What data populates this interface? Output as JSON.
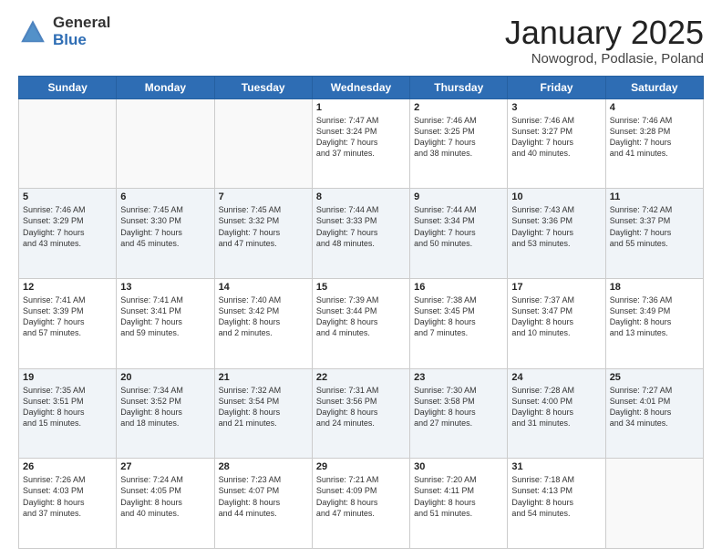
{
  "logo": {
    "general": "General",
    "blue": "Blue"
  },
  "title": {
    "month": "January 2025",
    "location": "Nowogrod, Podlasie, Poland"
  },
  "weekdays": [
    "Sunday",
    "Monday",
    "Tuesday",
    "Wednesday",
    "Thursday",
    "Friday",
    "Saturday"
  ],
  "weeks": [
    [
      {
        "day": "",
        "text": ""
      },
      {
        "day": "",
        "text": ""
      },
      {
        "day": "",
        "text": ""
      },
      {
        "day": "1",
        "text": "Sunrise: 7:47 AM\nSunset: 3:24 PM\nDaylight: 7 hours\nand 37 minutes."
      },
      {
        "day": "2",
        "text": "Sunrise: 7:46 AM\nSunset: 3:25 PM\nDaylight: 7 hours\nand 38 minutes."
      },
      {
        "day": "3",
        "text": "Sunrise: 7:46 AM\nSunset: 3:27 PM\nDaylight: 7 hours\nand 40 minutes."
      },
      {
        "day": "4",
        "text": "Sunrise: 7:46 AM\nSunset: 3:28 PM\nDaylight: 7 hours\nand 41 minutes."
      }
    ],
    [
      {
        "day": "5",
        "text": "Sunrise: 7:46 AM\nSunset: 3:29 PM\nDaylight: 7 hours\nand 43 minutes."
      },
      {
        "day": "6",
        "text": "Sunrise: 7:45 AM\nSunset: 3:30 PM\nDaylight: 7 hours\nand 45 minutes."
      },
      {
        "day": "7",
        "text": "Sunrise: 7:45 AM\nSunset: 3:32 PM\nDaylight: 7 hours\nand 47 minutes."
      },
      {
        "day": "8",
        "text": "Sunrise: 7:44 AM\nSunset: 3:33 PM\nDaylight: 7 hours\nand 48 minutes."
      },
      {
        "day": "9",
        "text": "Sunrise: 7:44 AM\nSunset: 3:34 PM\nDaylight: 7 hours\nand 50 minutes."
      },
      {
        "day": "10",
        "text": "Sunrise: 7:43 AM\nSunset: 3:36 PM\nDaylight: 7 hours\nand 53 minutes."
      },
      {
        "day": "11",
        "text": "Sunrise: 7:42 AM\nSunset: 3:37 PM\nDaylight: 7 hours\nand 55 minutes."
      }
    ],
    [
      {
        "day": "12",
        "text": "Sunrise: 7:41 AM\nSunset: 3:39 PM\nDaylight: 7 hours\nand 57 minutes."
      },
      {
        "day": "13",
        "text": "Sunrise: 7:41 AM\nSunset: 3:41 PM\nDaylight: 7 hours\nand 59 minutes."
      },
      {
        "day": "14",
        "text": "Sunrise: 7:40 AM\nSunset: 3:42 PM\nDaylight: 8 hours\nand 2 minutes."
      },
      {
        "day": "15",
        "text": "Sunrise: 7:39 AM\nSunset: 3:44 PM\nDaylight: 8 hours\nand 4 minutes."
      },
      {
        "day": "16",
        "text": "Sunrise: 7:38 AM\nSunset: 3:45 PM\nDaylight: 8 hours\nand 7 minutes."
      },
      {
        "day": "17",
        "text": "Sunrise: 7:37 AM\nSunset: 3:47 PM\nDaylight: 8 hours\nand 10 minutes."
      },
      {
        "day": "18",
        "text": "Sunrise: 7:36 AM\nSunset: 3:49 PM\nDaylight: 8 hours\nand 13 minutes."
      }
    ],
    [
      {
        "day": "19",
        "text": "Sunrise: 7:35 AM\nSunset: 3:51 PM\nDaylight: 8 hours\nand 15 minutes."
      },
      {
        "day": "20",
        "text": "Sunrise: 7:34 AM\nSunset: 3:52 PM\nDaylight: 8 hours\nand 18 minutes."
      },
      {
        "day": "21",
        "text": "Sunrise: 7:32 AM\nSunset: 3:54 PM\nDaylight: 8 hours\nand 21 minutes."
      },
      {
        "day": "22",
        "text": "Sunrise: 7:31 AM\nSunset: 3:56 PM\nDaylight: 8 hours\nand 24 minutes."
      },
      {
        "day": "23",
        "text": "Sunrise: 7:30 AM\nSunset: 3:58 PM\nDaylight: 8 hours\nand 27 minutes."
      },
      {
        "day": "24",
        "text": "Sunrise: 7:28 AM\nSunset: 4:00 PM\nDaylight: 8 hours\nand 31 minutes."
      },
      {
        "day": "25",
        "text": "Sunrise: 7:27 AM\nSunset: 4:01 PM\nDaylight: 8 hours\nand 34 minutes."
      }
    ],
    [
      {
        "day": "26",
        "text": "Sunrise: 7:26 AM\nSunset: 4:03 PM\nDaylight: 8 hours\nand 37 minutes."
      },
      {
        "day": "27",
        "text": "Sunrise: 7:24 AM\nSunset: 4:05 PM\nDaylight: 8 hours\nand 40 minutes."
      },
      {
        "day": "28",
        "text": "Sunrise: 7:23 AM\nSunset: 4:07 PM\nDaylight: 8 hours\nand 44 minutes."
      },
      {
        "day": "29",
        "text": "Sunrise: 7:21 AM\nSunset: 4:09 PM\nDaylight: 8 hours\nand 47 minutes."
      },
      {
        "day": "30",
        "text": "Sunrise: 7:20 AM\nSunset: 4:11 PM\nDaylight: 8 hours\nand 51 minutes."
      },
      {
        "day": "31",
        "text": "Sunrise: 7:18 AM\nSunset: 4:13 PM\nDaylight: 8 hours\nand 54 minutes."
      },
      {
        "day": "",
        "text": ""
      }
    ]
  ]
}
